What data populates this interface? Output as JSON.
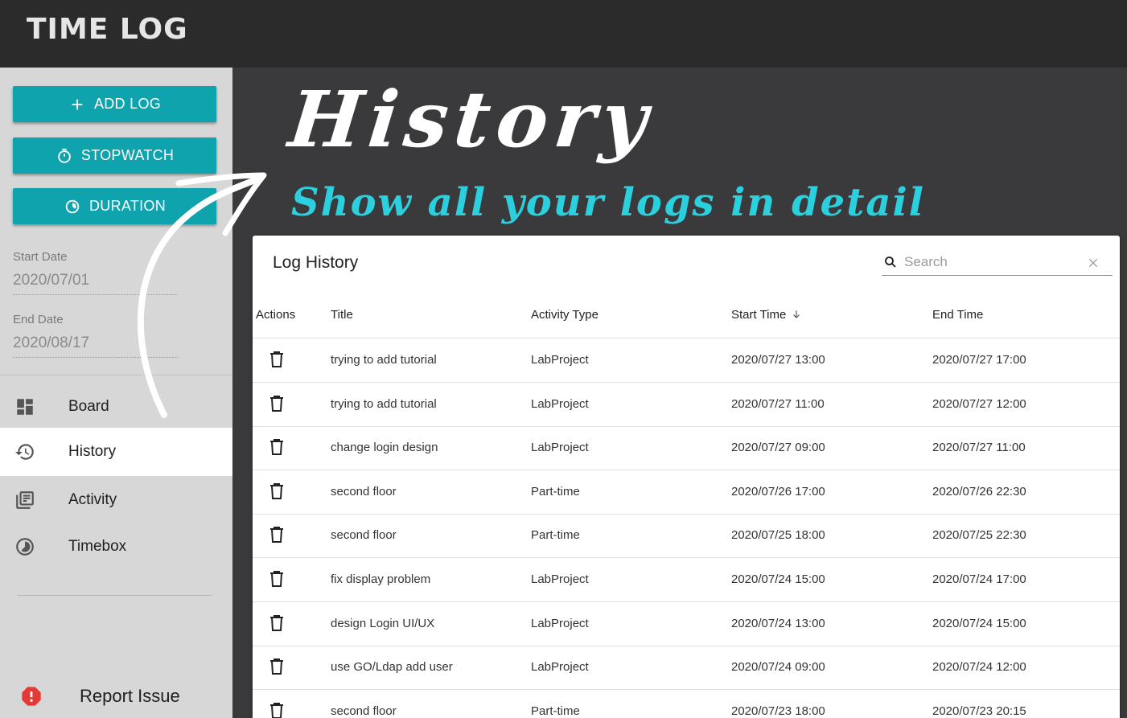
{
  "app": {
    "title": "TIME LOG"
  },
  "hero": {
    "title": "History",
    "subtitle": "Show all your logs in detail"
  },
  "sidebar": {
    "buttons": {
      "add_log": "ADD LOG",
      "stopwatch": "STOPWATCH",
      "duration": "DURATION"
    },
    "start_date": {
      "label": "Start Date",
      "value": "2020/07/01"
    },
    "end_date": {
      "label": "End Date",
      "value": "2020/08/17"
    },
    "nav": [
      {
        "label": "Board",
        "icon": "dashboard-icon"
      },
      {
        "label": "History",
        "icon": "history-icon",
        "active": true
      },
      {
        "label": "Activity",
        "icon": "library-books-icon"
      },
      {
        "label": "Timebox",
        "icon": "timelapse-icon"
      }
    ],
    "report": {
      "label": "Report Issue",
      "icon": "error-icon"
    }
  },
  "panel": {
    "title": "Log History",
    "search_placeholder": "Search",
    "columns": {
      "actions": "Actions",
      "title": "Title",
      "type": "Activity Type",
      "start": "Start Time",
      "end": "End Time"
    },
    "rows": [
      {
        "title": "trying to add tutorial",
        "type": "LabProject",
        "start": "2020/07/27 13:00",
        "end": "2020/07/27 17:00"
      },
      {
        "title": "trying to add tutorial",
        "type": "LabProject",
        "start": "2020/07/27 11:00",
        "end": "2020/07/27 12:00"
      },
      {
        "title": "change login design",
        "type": "LabProject",
        "start": "2020/07/27 09:00",
        "end": "2020/07/27 11:00"
      },
      {
        "title": "second floor",
        "type": "Part-time",
        "start": "2020/07/26 17:00",
        "end": "2020/07/26 22:30"
      },
      {
        "title": "second floor",
        "type": "Part-time",
        "start": "2020/07/25 18:00",
        "end": "2020/07/25 22:30"
      },
      {
        "title": "fix display problem",
        "type": "LabProject",
        "start": "2020/07/24 15:00",
        "end": "2020/07/24 17:00"
      },
      {
        "title": "design Login UI/UX",
        "type": "LabProject",
        "start": "2020/07/24 13:00",
        "end": "2020/07/24 15:00"
      },
      {
        "title": "use GO/Ldap add user",
        "type": "LabProject",
        "start": "2020/07/24 09:00",
        "end": "2020/07/24 12:00"
      },
      {
        "title": "second floor",
        "type": "Part-time",
        "start": "2020/07/23 18:00",
        "end": "2020/07/23 20:15"
      }
    ]
  },
  "colors": {
    "accent": "#0fa3ae",
    "appbar": "#2b2b2b",
    "sidebar": "#d7d7d7",
    "hero_subtitle": "#2bd0df",
    "report_icon": "#e53935"
  }
}
